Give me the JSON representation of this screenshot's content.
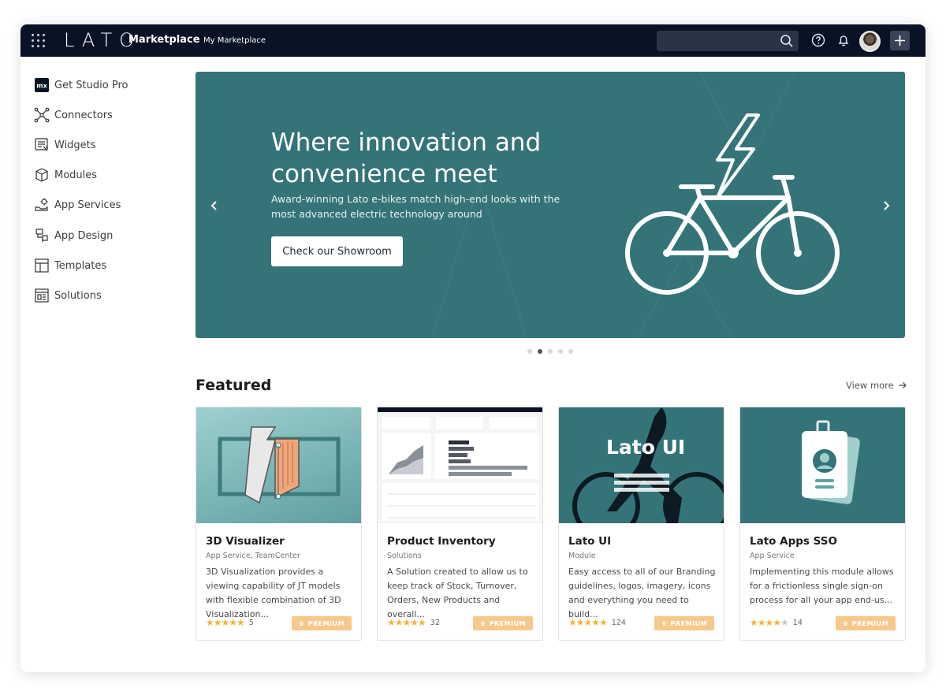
{
  "topbar": {
    "logo": "LATO",
    "app_name": "Marketplace",
    "my_marketplace": "My Marketplace",
    "search_placeholder": "",
    "icons": [
      "apps-grid-icon",
      "search-icon",
      "help-icon",
      "bell-icon",
      "avatar",
      "plus-icon"
    ]
  },
  "sidebar": {
    "items": [
      {
        "label": "Get Studio Pro",
        "icon": "mx-logo-icon"
      },
      {
        "label": "Connectors",
        "icon": "connectors-icon"
      },
      {
        "label": "Widgets",
        "icon": "widgets-icon"
      },
      {
        "label": "Modules",
        "icon": "modules-icon"
      },
      {
        "label": "App Services",
        "icon": "app-services-icon"
      },
      {
        "label": "App Design",
        "icon": "app-design-icon"
      },
      {
        "label": "Templates",
        "icon": "templates-icon"
      },
      {
        "label": "Solutions",
        "icon": "solutions-icon"
      }
    ]
  },
  "hero": {
    "title": "Where innovation and convenience meet",
    "subtitle": "Award-winning Lato e-bikes match high-end looks with the most advanced electric technology around",
    "button": "Check our Showroom",
    "bg_color": "#347478",
    "active_slide": 2,
    "slide_count": 5
  },
  "featured": {
    "heading": "Featured",
    "view_more": "View more",
    "cards": [
      {
        "title": "3D Visualizer",
        "category": "App Service, TeamCenter",
        "description": "3D Visualization provides a viewing capability of JT models with flexible combination of 3D Visualization...",
        "rating": 5,
        "count": "5",
        "badge": "PREMIUM"
      },
      {
        "title": "Product Inventory",
        "category": "Solutions",
        "description": "A Solution created to allow us to keep track of Stock, Turnover, Orders, New Products and overall...",
        "rating": 5,
        "count": "32",
        "badge": "PREMIUM"
      },
      {
        "title": "Lato UI",
        "category": "Module",
        "description": "Easy access to all of our Branding guidelines, logos, imagery, icons and everything you need to build...",
        "rating": 5,
        "count": "124",
        "badge": "PREMIUM",
        "image_text": "Lato UI"
      },
      {
        "title": "Lato Apps SSO",
        "category": "App Service",
        "description": "Implementing this module allows for a frictionless single sign-on process for all your app end-us...",
        "rating": 4,
        "count": "14",
        "badge": "PREMIUM"
      }
    ]
  },
  "colors": {
    "topbar": "#0a1326",
    "accent": "#347478",
    "premium": "#f7c88b",
    "star": "#f4b23a"
  }
}
